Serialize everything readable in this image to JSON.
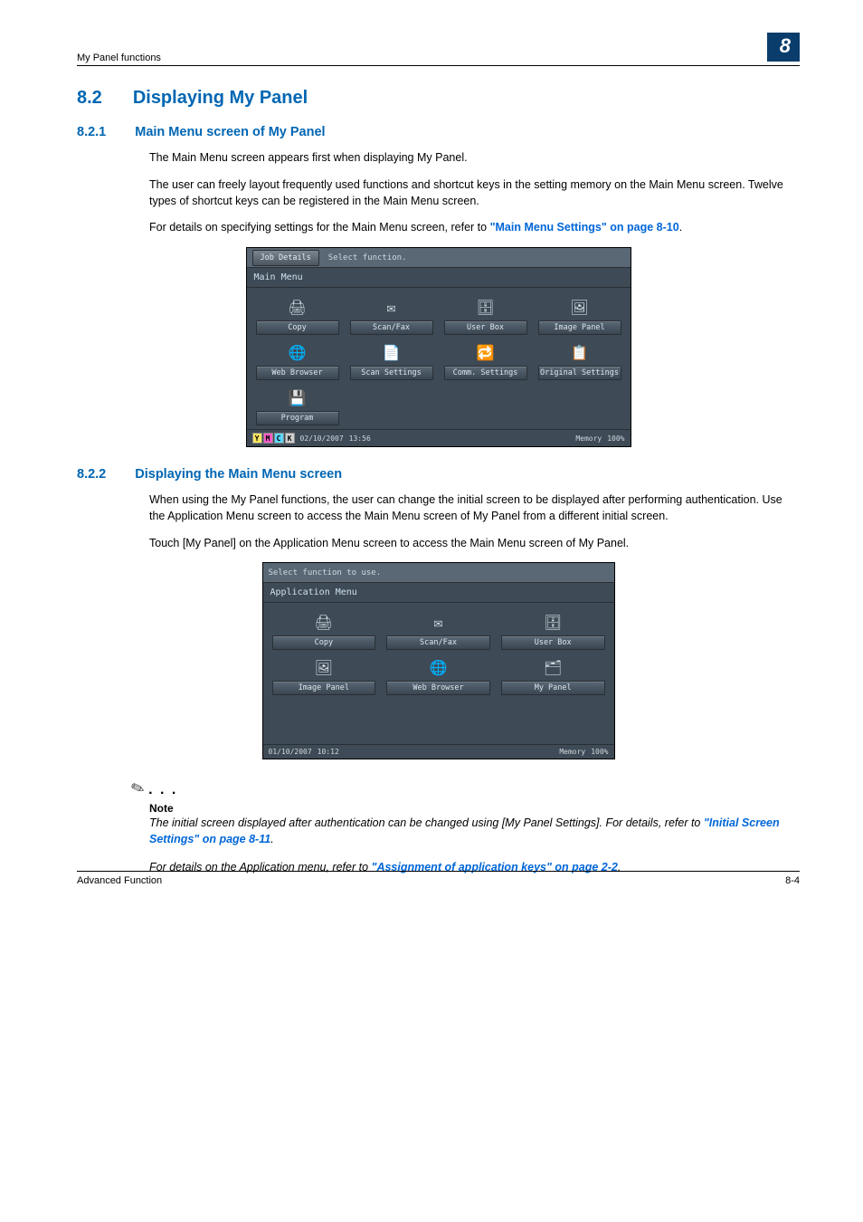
{
  "header": {
    "breadcrumb": "My Panel functions",
    "chapter": "8"
  },
  "section": {
    "num": "8.2",
    "title": "Displaying My Panel"
  },
  "sub1": {
    "num": "8.2.1",
    "title": "Main Menu screen of My Panel",
    "p1": "The Main Menu screen appears first when displaying My Panel.",
    "p2": "The user can freely layout frequently used functions and shortcut keys in the setting memory on the Main Menu screen. Twelve types of shortcut keys can be registered in the Main Menu screen.",
    "p3a": "For details on specifying settings for the Main Menu screen, refer to ",
    "p3link": "\"Main Menu Settings\" on page 8-10",
    "p3b": "."
  },
  "panel1": {
    "jobDetails": "Job Details",
    "instruction": "Select function.",
    "title": "Main Menu",
    "rows": [
      [
        {
          "label": "Copy",
          "icon": "🖨"
        },
        {
          "label": "Scan/Fax",
          "icon": "✉"
        },
        {
          "label": "User Box",
          "icon": "🗄"
        },
        {
          "label": "Image Panel",
          "icon": "🖼"
        }
      ],
      [
        {
          "label": "Web Browser",
          "icon": "🌐"
        },
        {
          "label": "Scan Settings",
          "icon": "📄"
        },
        {
          "label": "Comm. Settings",
          "icon": "🔁"
        },
        {
          "label": "Original Settings",
          "icon": "📋"
        }
      ],
      [
        {
          "label": "Program",
          "icon": "💾"
        },
        null,
        null,
        null
      ]
    ],
    "status": {
      "date": "02/10/2007",
      "time": "13:56",
      "memLabel": "Memory",
      "mem": "100%"
    }
  },
  "sub2": {
    "num": "8.2.2",
    "title": "Displaying the Main Menu screen",
    "p1": "When using the My Panel functions, the user can change the initial screen to be displayed after performing authentication. Use the Application Menu screen to access the Main Menu screen of My Panel from a different initial screen.",
    "p2": "Touch [My Panel] on the Application Menu screen to access the Main Menu screen of My Panel."
  },
  "panel2": {
    "instruction": "Select function to use.",
    "title": "Application Menu",
    "rows": [
      [
        {
          "label": "Copy",
          "icon": "🖨"
        },
        {
          "label": "Scan/Fax",
          "icon": "✉"
        },
        {
          "label": "User Box",
          "icon": "🗄"
        }
      ],
      [
        {
          "label": "Image Panel",
          "icon": "🖼"
        },
        {
          "label": "Web Browser",
          "icon": "🌐"
        },
        {
          "label": "My Panel",
          "icon": "🗂"
        }
      ]
    ],
    "status": {
      "date": "01/10/2007",
      "time": "10:12",
      "memLabel": "Memory",
      "mem": "100%"
    }
  },
  "note": {
    "label": "Note",
    "p1a": "The initial screen displayed after authentication can be changed using [My Panel Settings]. For details, refer to ",
    "p1link": "\"Initial Screen Settings\" on page 8-11",
    "p1b": ".",
    "p2a": "For details on the Application menu, refer to ",
    "p2link": "\"Assignment of application keys\" on page 2-2",
    "p2b": "."
  },
  "footer": {
    "left": "Advanced Function",
    "right": "8-4"
  }
}
